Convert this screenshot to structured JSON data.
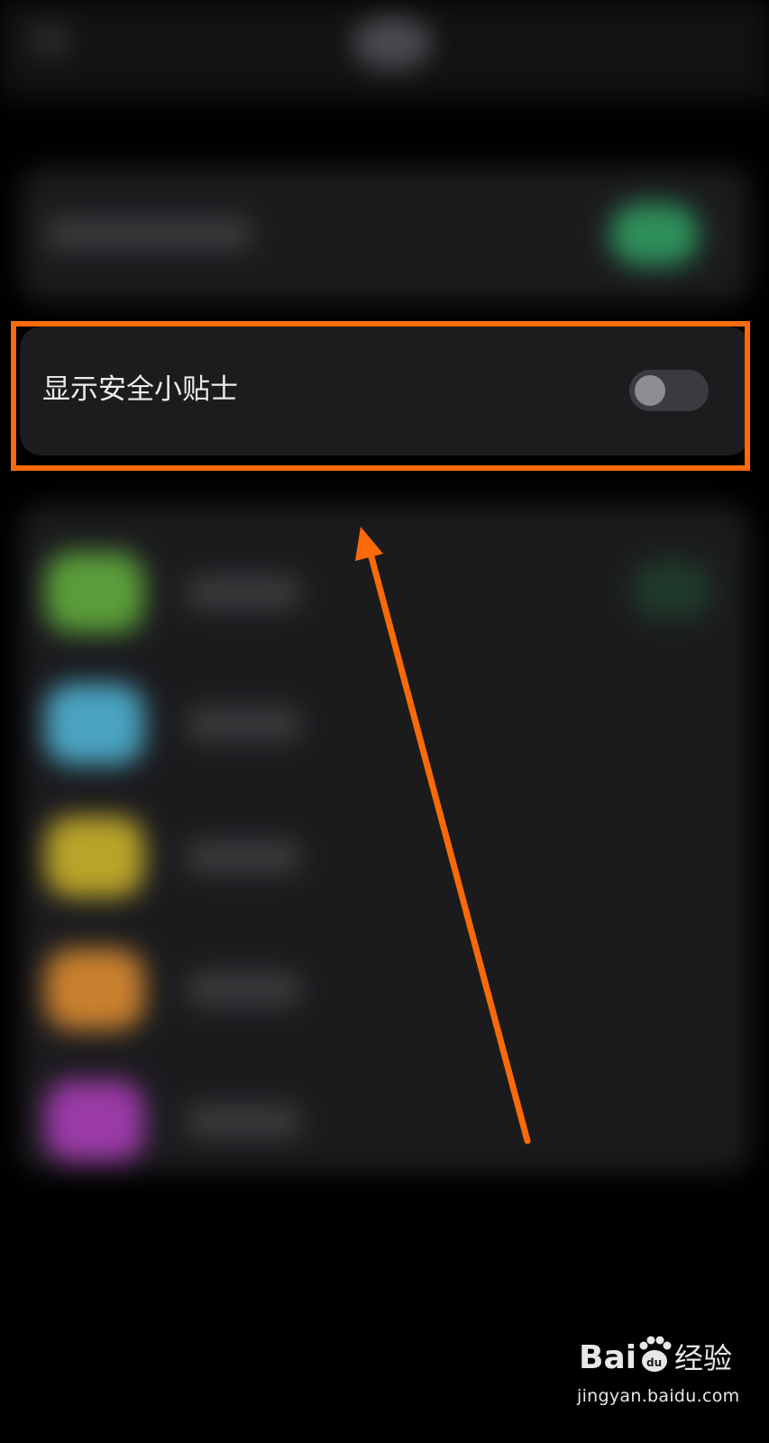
{
  "setting": {
    "label": "显示安全小贴士",
    "toggle_state": "off"
  },
  "colors": {
    "background": "#000000",
    "card": "#1c1c1f",
    "annotation": "#fb6a08",
    "toggle_track_off": "#3b3b3f",
    "toggle_knob": "#8e8e92",
    "toggle_on_blurred": "#2e8f5a",
    "icon_green": "#5a9c3a",
    "icon_cyan": "#4aa3c0",
    "icon_yellow": "#b9a32a",
    "icon_orange": "#c8802e",
    "icon_purple": "#9a3aa6"
  },
  "icons": {
    "top_blob": "blurred-status-icon",
    "toggle_blurred": "blurred-toggle-on",
    "list_icons": [
      "green-app-icon",
      "cyan-app-icon",
      "yellow-app-icon",
      "orange-app-icon",
      "purple-app-icon"
    ]
  },
  "watermark": {
    "brand": "Baidu经验",
    "url": "jingyan.baidu.com"
  }
}
